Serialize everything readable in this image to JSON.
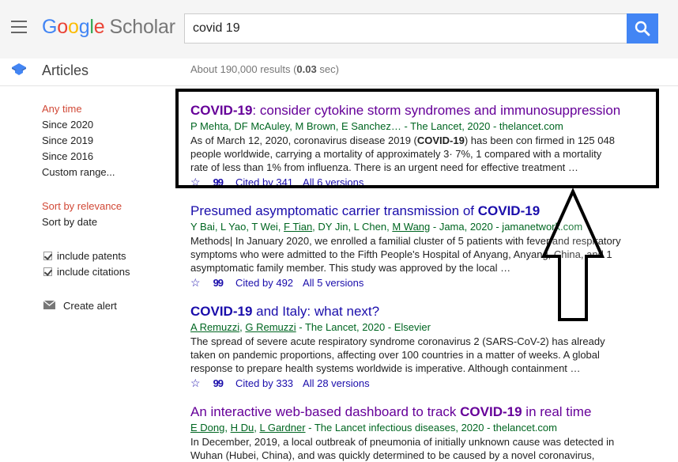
{
  "header": {
    "logo": {
      "google": [
        "G",
        "o",
        "o",
        "g",
        "l",
        "e"
      ],
      "scholar": "Scholar"
    },
    "search": {
      "value": "covid 19"
    }
  },
  "subheader": {
    "section_label": "Articles",
    "results_prefix": "About 190,000 results (",
    "results_time": "0.03",
    "results_suffix": " sec)"
  },
  "sidebar": {
    "time_filters": [
      "Any time",
      "Since 2020",
      "Since 2019",
      "Since 2016",
      "Custom range..."
    ],
    "sort_options": [
      "Sort by relevance",
      "Sort by date"
    ],
    "checkboxes": [
      {
        "label": "include patents",
        "checked": true
      },
      {
        "label": "include citations",
        "checked": true
      }
    ],
    "create_alert": "Create alert"
  },
  "results": [
    {
      "title_bold": "COVID-19",
      "title_rest": ": consider cytokine storm syndromes and immunosuppression",
      "authors": "P Mehta, DF McAuley, M Brown, E Sanchez… - The Lancet, 2020 - thelancet.com",
      "snippet_pre": "As of March 12, 2020, coronavirus disease 2019 (",
      "snippet_bold": "COVID-19",
      "snippet_post": ") has been con firmed in 125 048 people worldwide, carrying a mortality of approximately 3· 7%, 1 compared with a mortality rate of less than 1% from influenza. There is an urgent need for effective treatment …",
      "cited_by": "Cited by 341",
      "versions": "All 6 versions"
    },
    {
      "title_rest": "Presumed asymptomatic carrier transmission of ",
      "title_bold": "COVID-19",
      "authors_plain_1": "Y Bai, L Yao, T Wei, ",
      "authors_link_1": "F Tian",
      "authors_plain_2": ", DY Jin, L Chen, ",
      "authors_link_2": "M Wang",
      "authors_plain_3": " - Jama, 2020 - jamanetwork.com",
      "snippet": "Methods| In January 2020, we enrolled a familial cluster of 5 patients with fever and respiratory symptoms who were admitted to the Fifth People's Hospital of Anyang, Anyang, China, and 1 asymptomatic family member. This study was approved by the local …",
      "cited_by": "Cited by 492",
      "versions": "All 5 versions"
    },
    {
      "title_bold": "COVID-19",
      "title_rest": " and Italy: what next?",
      "authors_link_1": "A Remuzzi",
      "authors_plain_1": ", ",
      "authors_link_2": "G Remuzzi",
      "authors_plain_2": " - The Lancet, 2020 - Elsevier",
      "snippet": "The spread of severe acute respiratory syndrome coronavirus 2 (SARS-CoV-2) has already taken on pandemic proportions, affecting over 100 countries in a matter of weeks. A global response to prepare health systems worldwide is imperative. Although containment …",
      "cited_by": "Cited by 333",
      "versions": "All 28 versions"
    },
    {
      "title_rest": "An interactive web-based dashboard to track ",
      "title_bold": "COVID-19",
      "title_rest_2": " in real time",
      "authors_link_1": "E Dong",
      "authors_plain_1": ", ",
      "authors_link_2": "H Du",
      "authors_plain_2": ", ",
      "authors_link_3": "L Gardner",
      "authors_plain_3": " - The Lancet infectious diseases, 2020 - thelancet.com",
      "snippet": "In December, 2019, a local outbreak of pneumonia of initially unknown cause was detected in Wuhan (Hubei, China), and was quickly determined to be caused by a novel coronavirus,"
    }
  ],
  "icons": {
    "menu": "hamburger-menu-icon",
    "search": "magnifier-icon",
    "articles": "scholar-cap-icon",
    "alert": "envelope-icon",
    "save": "star-icon",
    "cite": "quote-icon",
    "annotation": "up-arrow-icon"
  },
  "colors": {
    "accent_blue": "#4285f4",
    "link": "#1a0dab",
    "visited": "#660099",
    "green": "#006621",
    "filter_active": "#d14836"
  }
}
